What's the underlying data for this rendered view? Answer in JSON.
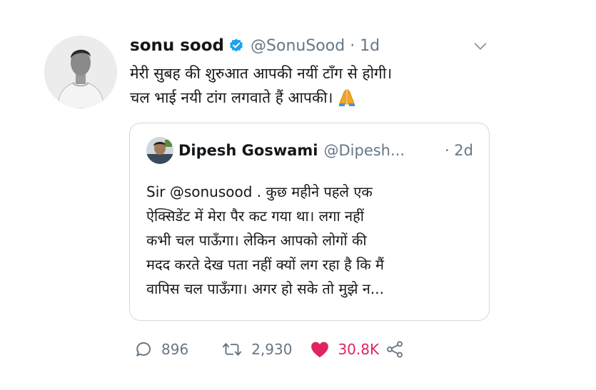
{
  "tweet": {
    "author_name": "sonu sood",
    "author_handle": "@SonuSood",
    "time": "· 1d",
    "text_lines": [
      "मेरी सुबह की शुरुआत आपकी नयीं टाँग से होगी।",
      "चल भाई नयी टांग लगवाते हैं आपकी।"
    ],
    "emoji": "folded-hands-emoji",
    "verified_icon": "verified-badge-icon",
    "menu_icon": "chevron-down-icon"
  },
  "quoted_tweet": {
    "author_name": "Dipesh Goswami",
    "author_handle": "@Dipesh...",
    "time": "· 2d",
    "text_lines": [
      "Sir @sonusood . कुछ महीने पहले  एक",
      "ऐक्सिडेंट में मेरा पैर कट गया था। लगा नहीं",
      "कभी चल पाऊँगा। लेकिन आपको लोगों की",
      "मदद करते देख पता नहीं क्यों लग रहा है कि मैं",
      "वापिस चल पाऊँगा। अगर हो सके तो मुझे न..."
    ]
  },
  "actions": {
    "replies": "896",
    "retweets": "2,930",
    "likes": "30.8K",
    "like_color": "#e0245e",
    "accent_color": "#1da1f2"
  }
}
